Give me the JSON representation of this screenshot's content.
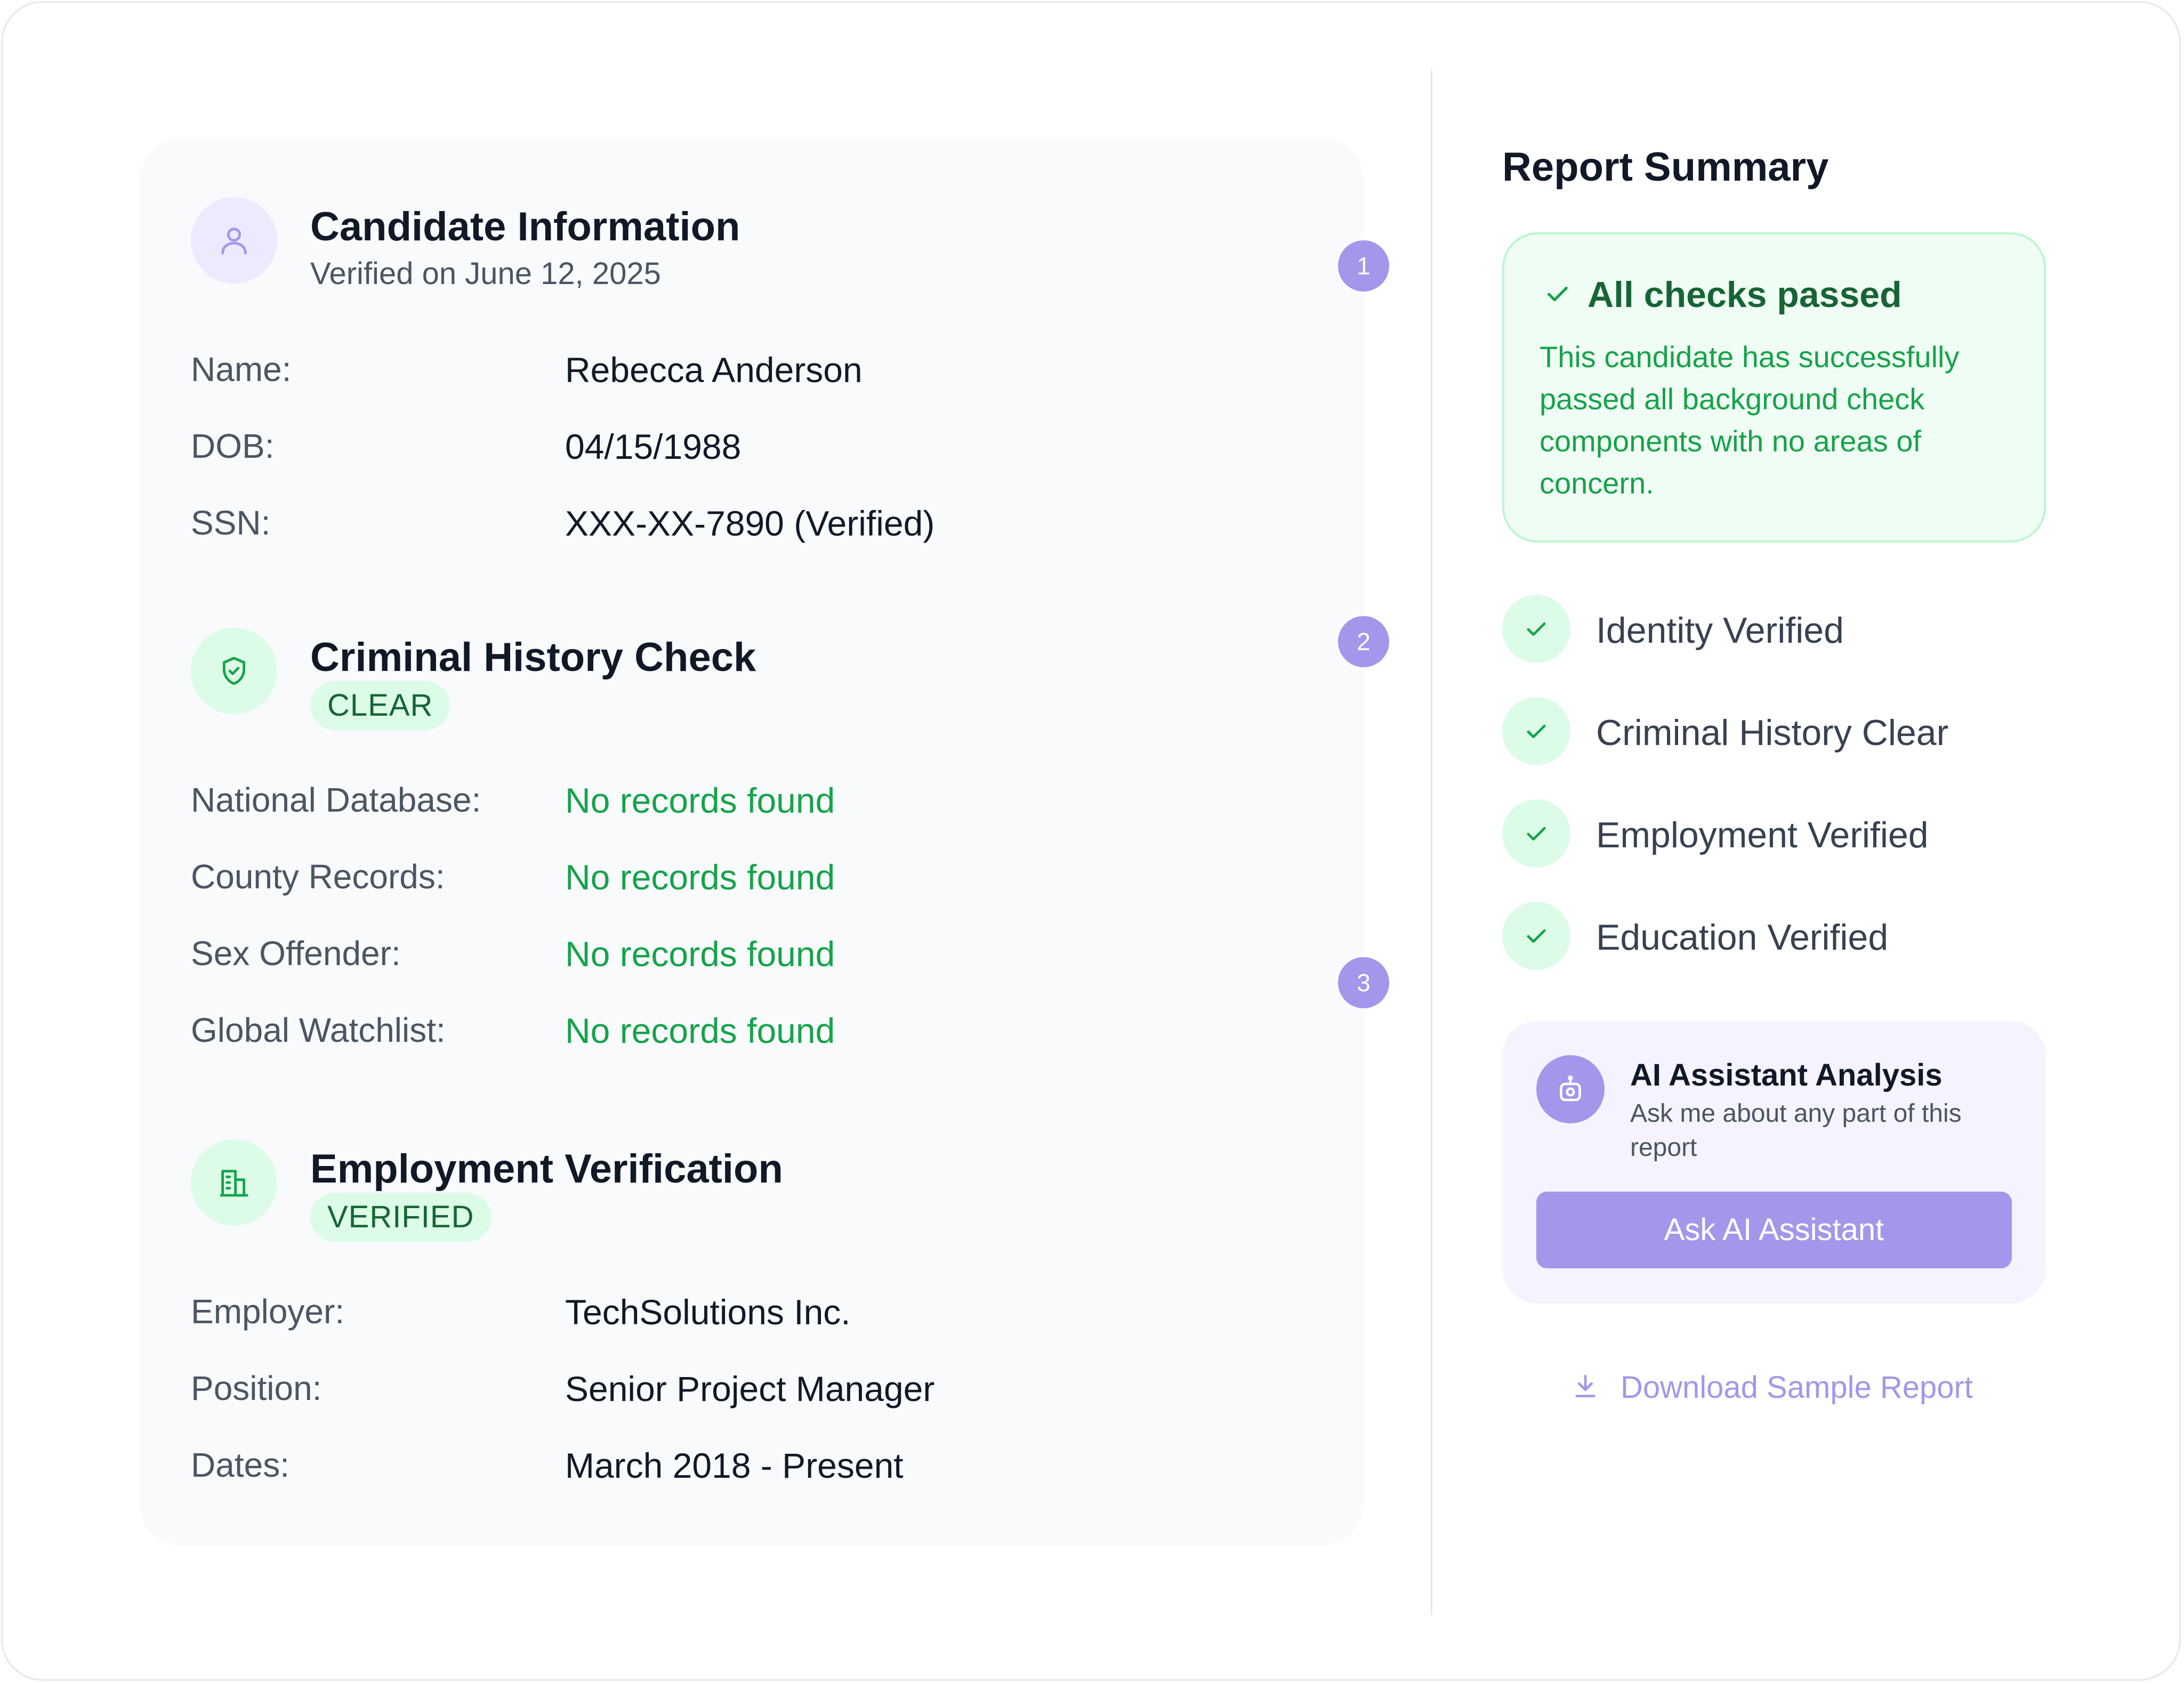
{
  "candidate": {
    "title": "Candidate Information",
    "subtitle": "Verified on June 12, 2025",
    "fields": [
      {
        "label": "Name:",
        "value": "Rebecca Anderson"
      },
      {
        "label": "DOB:",
        "value": "04/15/1988"
      },
      {
        "label": "SSN:",
        "value": "XXX-XX-7890 (Verified)"
      }
    ]
  },
  "criminal": {
    "title": "Criminal History Check",
    "badge": "CLEAR",
    "fields": [
      {
        "label": "National Database:",
        "value": "No records found"
      },
      {
        "label": "County Records:",
        "value": "No records found"
      },
      {
        "label": "Sex Offender:",
        "value": "No records found"
      },
      {
        "label": "Global Watchlist:",
        "value": "No records found"
      }
    ]
  },
  "employment": {
    "title": "Employment Verification",
    "badge": "VERIFIED",
    "fields": [
      {
        "label": "Employer:",
        "value": "TechSolutions Inc."
      },
      {
        "label": "Position:",
        "value": "Senior Project Manager"
      },
      {
        "label": "Dates:",
        "value": "March 2018 - Present"
      }
    ]
  },
  "steps": [
    "1",
    "2",
    "3"
  ],
  "summary": {
    "title": "Report Summary",
    "status_title": "All checks passed",
    "status_body": "This candidate has successfully passed all background check components with no areas of concern.",
    "checks": [
      "Identity Verified",
      "Criminal History Clear",
      "Employment Verified",
      "Education Verified"
    ]
  },
  "ai": {
    "title": "AI Assistant Analysis",
    "subtitle": "Ask me about any part of this report",
    "button": "Ask AI Assistant"
  },
  "download": {
    "label": "Download Sample Report"
  },
  "colors": {
    "accent": "#a297ea",
    "success": "#16a34a",
    "success_dark": "#166534",
    "success_bg": "#dcfce7",
    "card_bg": "#f8fafc"
  }
}
